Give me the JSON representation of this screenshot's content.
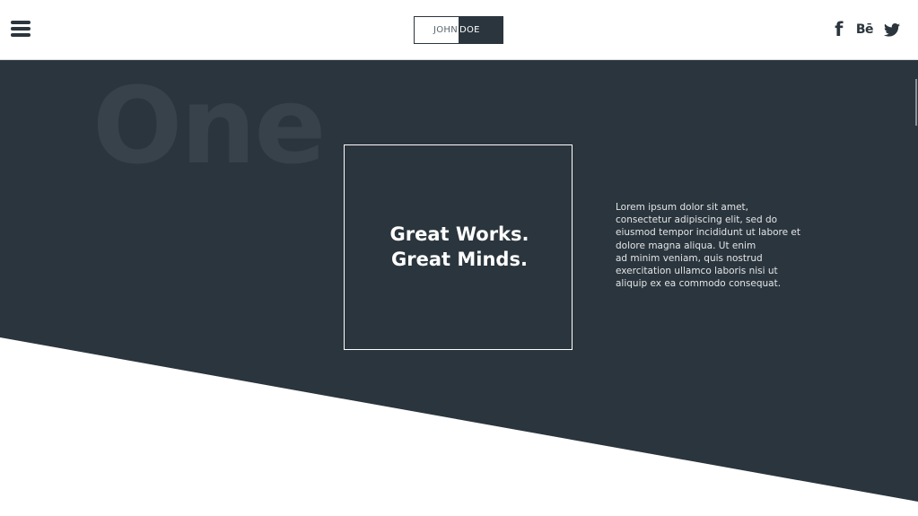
{
  "header": {
    "menu_icon": "hamburger-menu-icon",
    "logo": {
      "first": "JOHN",
      "last": "DOE"
    },
    "social": [
      {
        "name": "facebook-icon",
        "label": "f"
      },
      {
        "name": "behance-icon",
        "label": "Bē"
      },
      {
        "name": "twitter-icon",
        "label": "twitter"
      }
    ]
  },
  "hero": {
    "big_word": "One",
    "headline": {
      "line1": "Great Works.",
      "line2": "Great Minds."
    },
    "body_lines": [
      "Lorem ipsum dolor sit amet,",
      "consectetur adipiscing elit, sed do",
      "eiusmod tempor incididunt ut labore et",
      "dolore magna aliqua. Ut enim",
      "ad minim veniam, quis nostrud",
      "exercitation ullamco laboris nisi ut",
      "aliquip ex ea commodo consequat."
    ]
  },
  "colors": {
    "dark": "#2b353d",
    "big_word": "#37424a",
    "white": "#ffffff"
  }
}
